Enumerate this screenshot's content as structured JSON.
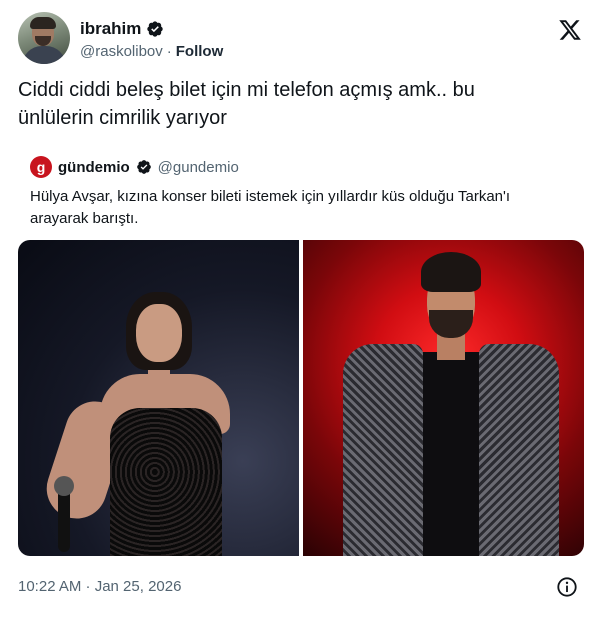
{
  "author": {
    "display_name": "ibrahim",
    "handle": "@raskolibov",
    "separator": "·",
    "follow_label": "Follow",
    "avatar_icon": "user-avatar",
    "verified_icon": "verified-badge-icon"
  },
  "brand_icon": "x-logo-icon",
  "tweet": {
    "text_line1": "Ciddi ciddi beleş bilet için mi telefon açmış amk.. bu",
    "text_line2": "ünlülerin cimrilik yarıyor"
  },
  "quote": {
    "avatar_letter": "g",
    "display_name": "gündemio",
    "handle": "@gundemio",
    "text_line1": "Hülya Avşar, kızına konser bileti istemek için yıllardır küs olduğu Tarkan'ı",
    "text_line2": "arayarak barıştı.",
    "photos": [
      "woman-on-stage-photo",
      "man-sequin-jacket-photo"
    ]
  },
  "footer": {
    "timestamp": "10:22 AM · Jan 25, 2026",
    "info_icon": "info-icon"
  },
  "colors": {
    "verified": "#0f1419",
    "secondary_text": "#536471",
    "brand_red": "#c8141e",
    "photo_red": "#d10d12"
  }
}
